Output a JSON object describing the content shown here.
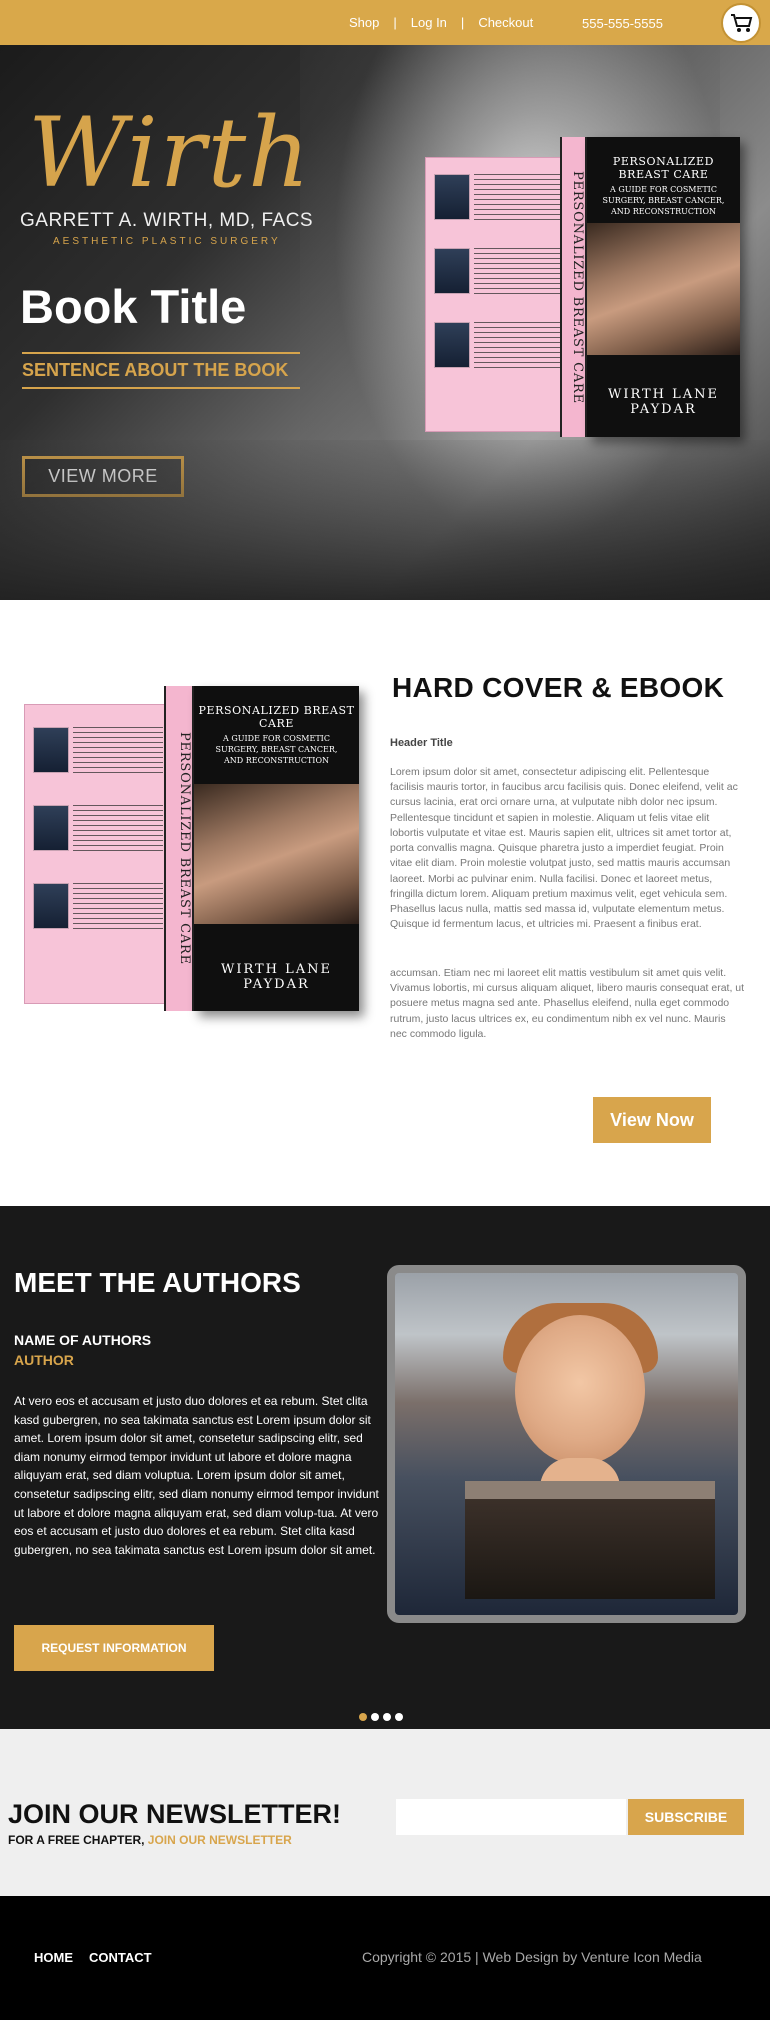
{
  "topbar": {
    "nav": [
      "Shop",
      "Log In",
      "Checkout"
    ],
    "phone": "555-555-5555"
  },
  "hero": {
    "logo_script": "Wirth",
    "logo_name": "GARRETT A. WIRTH, MD, FACS",
    "logo_subtitle": "AESTHETIC PLASTIC SURGERY",
    "book_title": "Book Title",
    "sentence": "SENTENCE ABOUT THE BOOK",
    "button": "VIEW MORE",
    "book": {
      "spine": "PERSONALIZED BREAST CARE",
      "spine_authors": "WIRTH LANE PAYDAR",
      "cover_title": "PERSONALIZED BREAST CARE",
      "cover_subtitle": "A GUIDE FOR COSMETIC SURGERY, BREAST CANCER, AND RECONSTRUCTION",
      "cover_authors": "WIRTH  LANE  PAYDAR"
    }
  },
  "hardcover": {
    "title": "HARD COVER & EBOOK",
    "header": "Header Title",
    "paragraph1": "Lorem ipsum dolor sit amet, consectetur adipiscing elit. Pellentesque facilisis mauris tortor, in faucibus arcu facilisis quis. Donec eleifend, velit ac cursus lacinia, erat orci ornare urna, at vulputate nibh dolor nec ipsum. Pellentesque tincidunt et sapien in molestie. Aliquam ut felis vitae elit lobortis vulputate et vitae est. Mauris sapien elit, ultrices sit amet tortor at, porta convallis magna. Quisque pharetra justo a imperdiet feugiat. Proin vitae elit diam. Proin molestie volutpat justo, sed mattis mauris accumsan laoreet. Morbi ac pulvinar enim. Nulla facilisi. Donec et laoreet metus, fringilla dictum lorem. Aliquam pretium maximus velit, eget vehicula sem. Phasellus lacus nulla, mattis sed massa id, vulputate elementum metus. Quisque id fermentum lacus, et ultricies mi. Praesent a finibus erat.",
    "paragraph2": "accumsan. Etiam nec mi laoreet elit mattis vestibulum sit amet quis velit. Vivamus lobortis, mi cursus aliquam aliquet, libero mauris consequat erat, ut posuere metus magna sed ante. Phasellus eleifend, nulla eget commodo rutrum, justo lacus ultrices ex, eu condimentum nibh ex vel nunc. Mauris nec commodo ligula.",
    "button": "View Now"
  },
  "authors": {
    "title": "MEET THE AUTHORS",
    "name": "NAME OF AUTHORS",
    "role": "AUTHOR",
    "text": "At vero eos et accusam et justo duo dolores et ea rebum. Stet clita kasd gubergren, no sea takimata sanctus est Lorem ipsum dolor sit amet. Lorem ipsum dolor sit amet, consetetur sadipscing elitr, sed diam nonumy eirmod tempor invidunt ut labore et dolore magna aliquyam erat, sed diam voluptua. Lorem ipsum dolor sit amet, consetetur sadipscing elitr, sed diam nonumy eirmod tempor invidunt ut labore et dolore magna aliquyam erat, sed diam volup-tua. At vero eos et accusam et justo duo dolores et ea rebum. Stet clita kasd gubergren, no sea takimata sanctus est Lorem ipsum dolor sit amet.",
    "button": "REQUEST INFORMATION",
    "carousel_dots": 4,
    "active_dot": 1
  },
  "newsletter": {
    "title": "JOIN OUR NEWSLETTER!",
    "subtitle": "FOR A FREE CHAPTER,",
    "subtitle_accent": "JOIN OUR NEWSLETTER",
    "input_value": "",
    "button": "SUBSCRIBE"
  },
  "footer": {
    "nav": [
      "HOME",
      "CONTACT"
    ],
    "copyright": "Copyright © 2015 | Web Design by Venture Icon Media"
  },
  "colors": {
    "accent": "#d8a54c",
    "dark": "#191919",
    "pink": "#f7c4d8"
  }
}
